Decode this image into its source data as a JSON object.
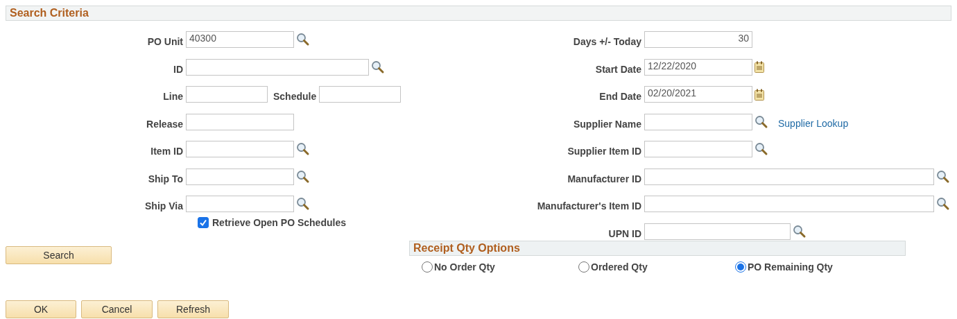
{
  "header": "Search Criteria",
  "left_rows": [
    {
      "fields": [
        {
          "label": "PO Unit",
          "value": "40300",
          "kind": "lookup"
        }
      ]
    },
    {
      "fields": [
        {
          "label": "ID",
          "kind": "lookup"
        }
      ]
    },
    {
      "fields": [
        {
          "label": "Line",
          "kind": "plain"
        },
        {
          "label": "Schedule",
          "kind": "plain"
        }
      ]
    },
    {
      "fields": [
        {
          "label": "Release",
          "kind": "plain"
        }
      ]
    },
    {
      "fields": [
        {
          "label": "Item ID",
          "kind": "lookup"
        }
      ]
    },
    {
      "fields": [
        {
          "label": "Ship To",
          "kind": "lookup"
        }
      ]
    },
    {
      "fields": [
        {
          "label": "Ship Via",
          "kind": "lookup"
        }
      ]
    }
  ],
  "checkbox": {
    "label": "Retrieve Open PO Schedules",
    "checked": true
  },
  "search_button": "Search",
  "right_rows": [
    {
      "label": "Days +/- Today",
      "value": "30",
      "kind": "number"
    },
    {
      "label": "Start Date",
      "value": "12/22/2020",
      "kind": "date"
    },
    {
      "label": "End Date",
      "value": "02/20/2021",
      "kind": "date"
    },
    {
      "label": "Supplier Name",
      "kind": "lookup",
      "link": "Supplier Lookup"
    },
    {
      "label": "Supplier Item ID",
      "kind": "lookup"
    },
    {
      "label": "Manufacturer ID",
      "kind": "lookup"
    },
    {
      "label": "Manufacturer's Item ID",
      "kind": "lookup"
    },
    {
      "label": "UPN ID",
      "kind": "lookup"
    }
  ],
  "receipt_options": {
    "title": "Receipt Qty Options",
    "options": [
      {
        "label": "No Order Qty",
        "selected": false
      },
      {
        "label": "Ordered Qty",
        "selected": false
      },
      {
        "label": "PO Remaining Qty",
        "selected": true
      }
    ]
  },
  "buttons": [
    "OK",
    "Cancel",
    "Refresh"
  ]
}
